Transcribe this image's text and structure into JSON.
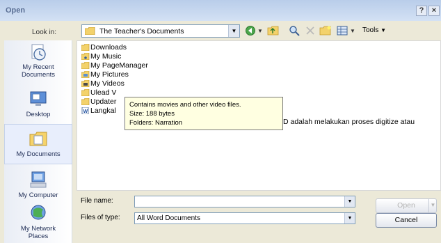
{
  "window": {
    "title": "Open",
    "help_button": "?",
    "close_button": "×"
  },
  "toolbar": {
    "look_in_label": "Look in:",
    "look_in_value": "The Teacher's Documents",
    "tools_label": "Tools"
  },
  "places": [
    {
      "label": "My Recent Documents",
      "icon": "recent-documents-icon"
    },
    {
      "label": "Desktop",
      "icon": "desktop-icon"
    },
    {
      "label": "My Documents",
      "icon": "my-documents-icon"
    },
    {
      "label": "My Computer",
      "icon": "my-computer-icon"
    },
    {
      "label": "My Network Places",
      "icon": "network-places-icon"
    }
  ],
  "files": [
    {
      "name": "Downloads",
      "icon": "folder-icon"
    },
    {
      "name": "My Music",
      "icon": "music-folder-icon"
    },
    {
      "name": "My PageManager",
      "icon": "folder-icon"
    },
    {
      "name": "My Pictures",
      "icon": "pictures-folder-icon"
    },
    {
      "name": "My Videos",
      "icon": "videos-folder-icon"
    },
    {
      "name": "Ulead V",
      "icon": "folder-icon"
    },
    {
      "name": "Updater",
      "icon": "folder-icon"
    },
    {
      "name": "Langkal",
      "icon": "word-document-icon",
      "trailing": "D adalah melakukan proses digitize atau"
    }
  ],
  "tooltip": {
    "line1": "Contains movies and other video files.",
    "line2": "Size: 188 bytes",
    "line3": "Folders: Narration"
  },
  "bottom": {
    "file_name_label": "File name:",
    "file_name_value": "",
    "file_type_label": "Files of type:",
    "file_type_value": "All Word Documents",
    "open_button": "Open",
    "cancel_button": "Cancel"
  }
}
